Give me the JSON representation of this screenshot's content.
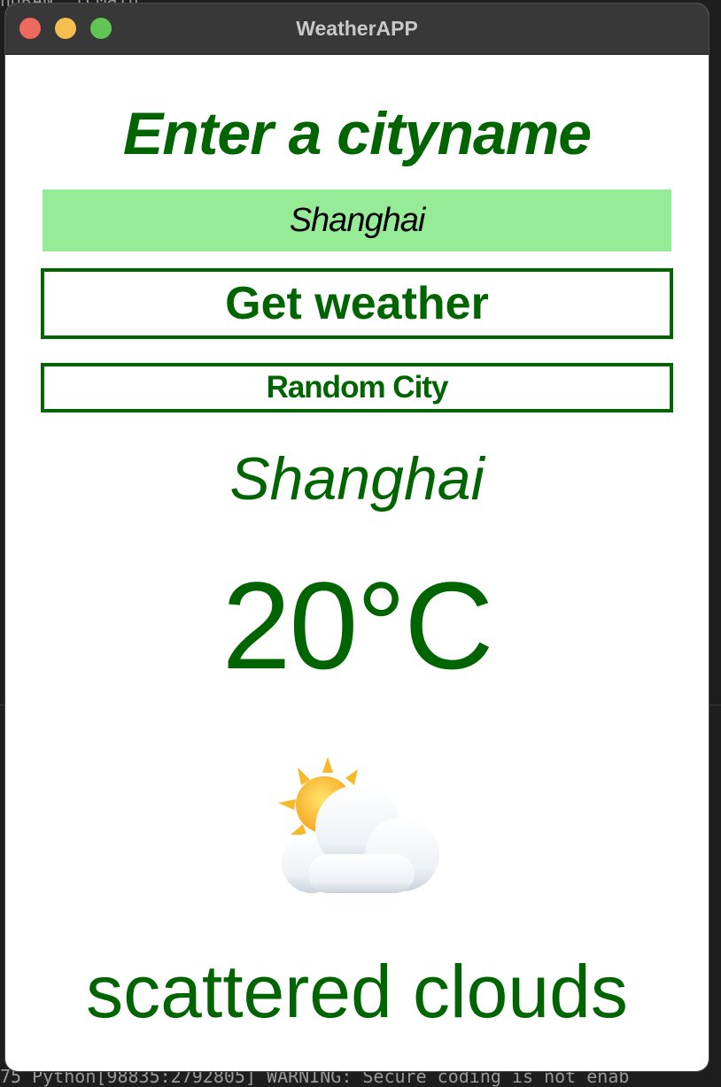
{
  "window": {
    "title": "WeatherAPP"
  },
  "app": {
    "heading": "Enter a cityname",
    "city_input_value": "Shanghai",
    "get_weather_label": "Get weather",
    "random_city_label": "Random City"
  },
  "result": {
    "city": "Shanghai",
    "temperature": "20°C",
    "icon": "sun-behind-cloud-icon",
    "description": "scattered clouds"
  },
  "background": {
    "top_fragment": "ndRAN `lCMain",
    "bottom_fragment": "75 Python[98835:2792805] WARNING: Secure coding is not enab"
  },
  "colors": {
    "accent": "#006400",
    "input_bg": "#96ec96"
  }
}
